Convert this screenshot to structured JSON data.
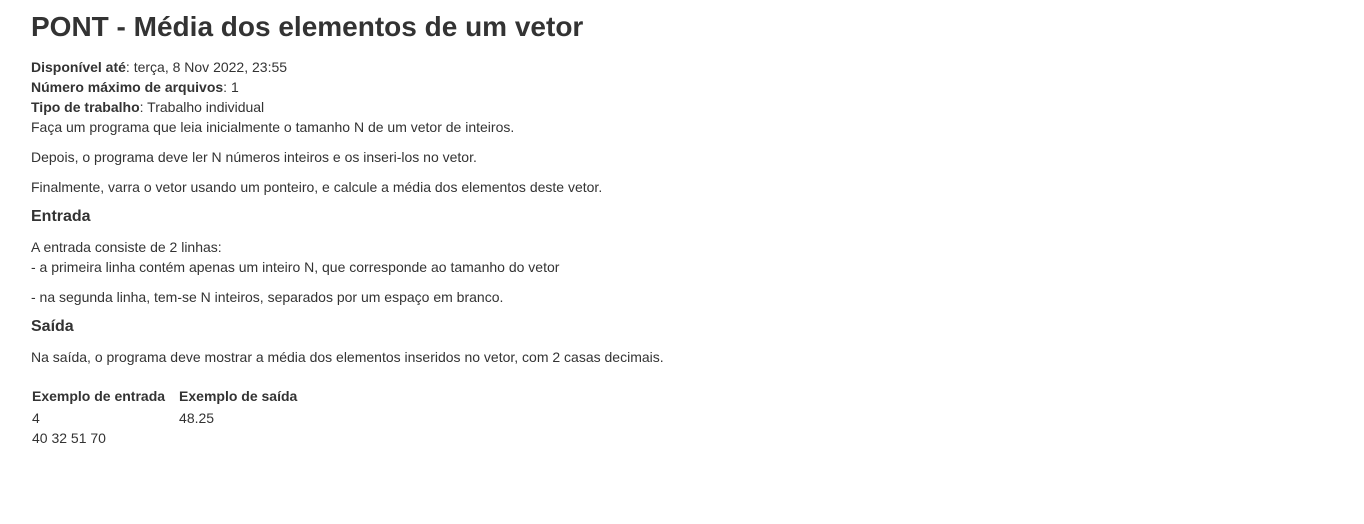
{
  "title": "PONT - Média dos elementos de um vetor",
  "meta": {
    "available_label": "Disponível até",
    "available_value": "terça, 8 Nov 2022, 23:55",
    "max_files_label": "Número máximo de arquivos",
    "max_files_value": "1",
    "work_type_label": "Tipo de trabalho",
    "work_type_value": "Trabalho individual"
  },
  "description": {
    "p1": "Faça um programa que leia inicialmente o tamanho N de um vetor de inteiros.",
    "p2": "Depois, o programa deve ler N números inteiros e os inseri-los no vetor.",
    "p3": "Finalmente, varra o vetor usando um ponteiro, e calcule a média dos elementos deste vetor."
  },
  "input_section": {
    "heading": "Entrada",
    "line1": "A entrada consiste de 2 linhas:",
    "line2": "- a primeira linha contém apenas um inteiro N, que corresponde ao tamanho do vetor",
    "line3": "- na segunda linha, tem-se N inteiros, separados por um espaço em branco."
  },
  "output_section": {
    "heading": "Saída",
    "text": "Na saída, o programa deve mostrar a média dos elementos inseridos no vetor, com 2 casas decimais."
  },
  "examples": {
    "input_header": "Exemplo de entrada",
    "output_header": "Exemplo de saída",
    "input_lines": [
      "4",
      "40 32 51 70"
    ],
    "output_lines": [
      "48.25"
    ]
  }
}
